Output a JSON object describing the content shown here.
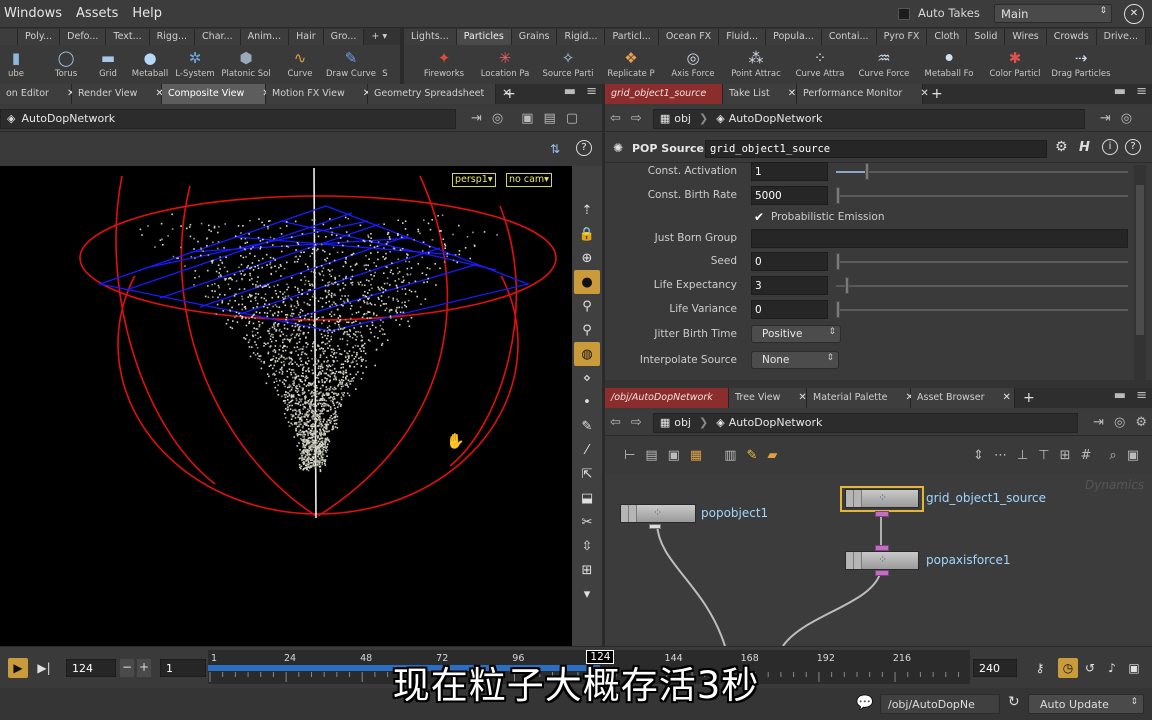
{
  "menubar": {
    "items": [
      "Windows",
      "Assets",
      "Help"
    ],
    "auto_takes_label": "Auto Takes",
    "take_name": "Main"
  },
  "shelf_left": {
    "tabs": [
      "Poly...",
      "Defo...",
      "Text...",
      "Rigg...",
      "Char...",
      "Anim...",
      "Hair",
      "Gro..."
    ],
    "tools": [
      "ube",
      "Torus",
      "Grid",
      "Metaball",
      "L-System",
      "Platonic Sol",
      "Curve",
      "Draw Curve",
      "S"
    ]
  },
  "shelf_right": {
    "tabs": [
      "Lights...",
      "Particles",
      "Grains",
      "Rigid...",
      "Particl...",
      "Ocean FX",
      "Fluid...",
      "Popula...",
      "Contai...",
      "Pyro FX",
      "Cloth",
      "Solid",
      "Wires",
      "Crowds",
      "Drive..."
    ],
    "active_tab": "Particles",
    "tools": [
      "Fireworks",
      "Location Pa",
      "Source Parti",
      "Replicate P",
      "Axis Force",
      "Point Attrac",
      "Curve Attra",
      "Curve Force",
      "Metaball Fo",
      "Color Particl",
      "Drag Particles"
    ]
  },
  "left_pane": {
    "tabs": [
      "on Editor",
      "Render View",
      "Composite View",
      "Motion FX View",
      "Geometry Spreadsheet"
    ],
    "selected_tab": "Composite View",
    "path": "AutoDopNetwork",
    "camera_label": "persp1",
    "cam_menu": "no cam"
  },
  "param_pane": {
    "tabs": [
      "grid_object1_source",
      "Take List",
      "Performance Monitor"
    ],
    "path_root": "obj",
    "path_node": "AutoDopNetwork",
    "node_type": "POP Source",
    "node_name": "grid_object1_source",
    "params": {
      "const_activation": {
        "label": "Const. Activation",
        "value": "1",
        "slider": 0.1
      },
      "const_birth_rate": {
        "label": "Const. Birth Rate",
        "value": "5000",
        "slider": 0.0
      },
      "probabilistic": {
        "label": "Probabilistic Emission",
        "checked": true
      },
      "just_born_group": {
        "label": "Just Born Group",
        "value": ""
      },
      "seed": {
        "label": "Seed",
        "value": "0",
        "slider": 0.0
      },
      "life_expectancy": {
        "label": "Life Expectancy",
        "value": "3",
        "slider": 0.03
      },
      "life_variance": {
        "label": "Life Variance",
        "value": "0",
        "slider": 0.0
      },
      "jitter_birth_time": {
        "label": "Jitter Birth Time",
        "value": "Positive"
      },
      "interpolate_source": {
        "label": "Interpolate Source",
        "value": "None"
      }
    }
  },
  "network_pane": {
    "tabs": [
      "/obj/AutoDopNetwork",
      "Tree View",
      "Material Palette",
      "Asset Browser"
    ],
    "path_root": "obj",
    "path_node": "AutoDopNetwork",
    "watermark": "Dynamics",
    "nodes": [
      "popobject1",
      "grid_object1_source",
      "popaxisforce1"
    ]
  },
  "timeline": {
    "current_frame": "124",
    "start_frame": "1",
    "end_frame": "240",
    "ticks": [
      "1",
      "24",
      "48",
      "72",
      "96",
      "124",
      "144",
      "168",
      "192",
      "216"
    ],
    "progress": 0.515
  },
  "statusbar": {
    "path": "/obj/AutoDopNe",
    "update_mode": "Auto Update"
  },
  "subtitle": "现在粒子大概存活3秒",
  "colors": {
    "selected_node": "#e3b63a",
    "node_label": "#9fd6ff",
    "grid_blue": "#1a1aff",
    "bounds_red": "#e01010",
    "timeline_blue": "#2b6fc4"
  }
}
